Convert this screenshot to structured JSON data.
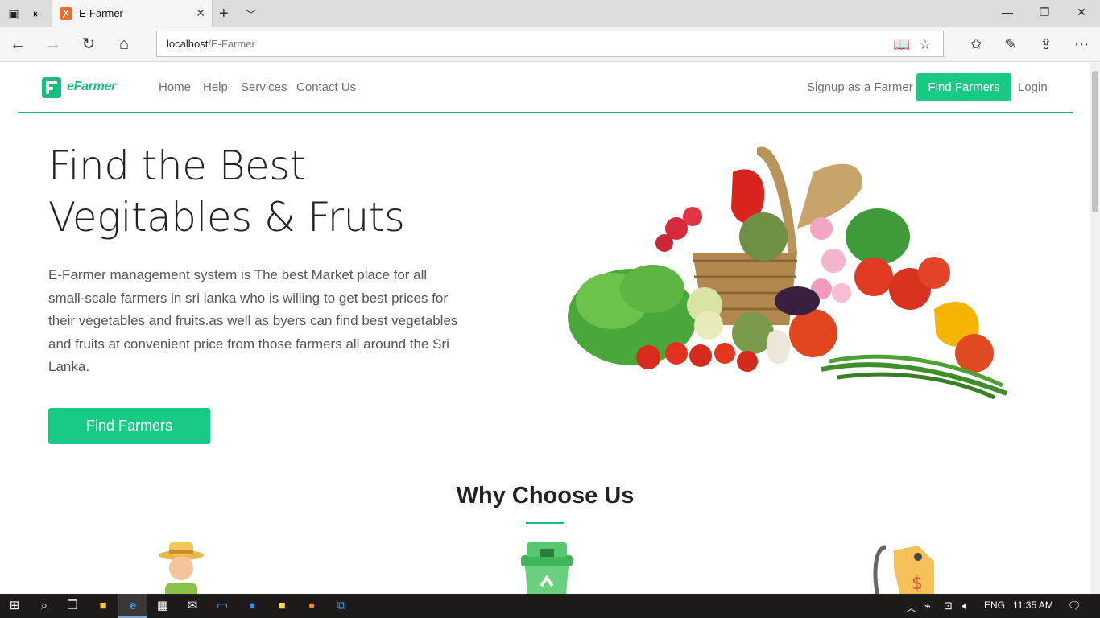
{
  "browser": {
    "tab": {
      "title": "E-Farmer",
      "favicon": "xampp-icon"
    },
    "address": {
      "host": "localhost",
      "path": "/E-Farmer"
    },
    "window_controls": [
      "—",
      "❐",
      "✕"
    ]
  },
  "site": {
    "logo_text": "eFarmer",
    "nav": {
      "links": [
        "Home",
        "Help",
        "Services",
        "Contact Us"
      ],
      "signup": "Signup as a Farmer",
      "find": "Find Farmers",
      "login": "Login"
    },
    "hero": {
      "title_line1": "Find the Best",
      "title_line2": "Vegitables & Fruts",
      "description": "E-Farmer management system is The best Market place for all small-scale farmers in sri lanka who is willing to get best prices for their vegetables and fruits.as well as byers can find best vegetables and fruits at convenient price from those farmers all around the Sri Lanka.",
      "cta": "Find Farmers"
    },
    "why": {
      "title": "Why Choose Us",
      "icons": [
        "farmer-icon",
        "recycle-bin-icon",
        "price-tag-icon"
      ]
    }
  },
  "taskbar": {
    "language": "ENG",
    "time": "11:35 AM"
  },
  "colors": {
    "brand_green": "#19c986",
    "header_line": "#17b07a"
  }
}
